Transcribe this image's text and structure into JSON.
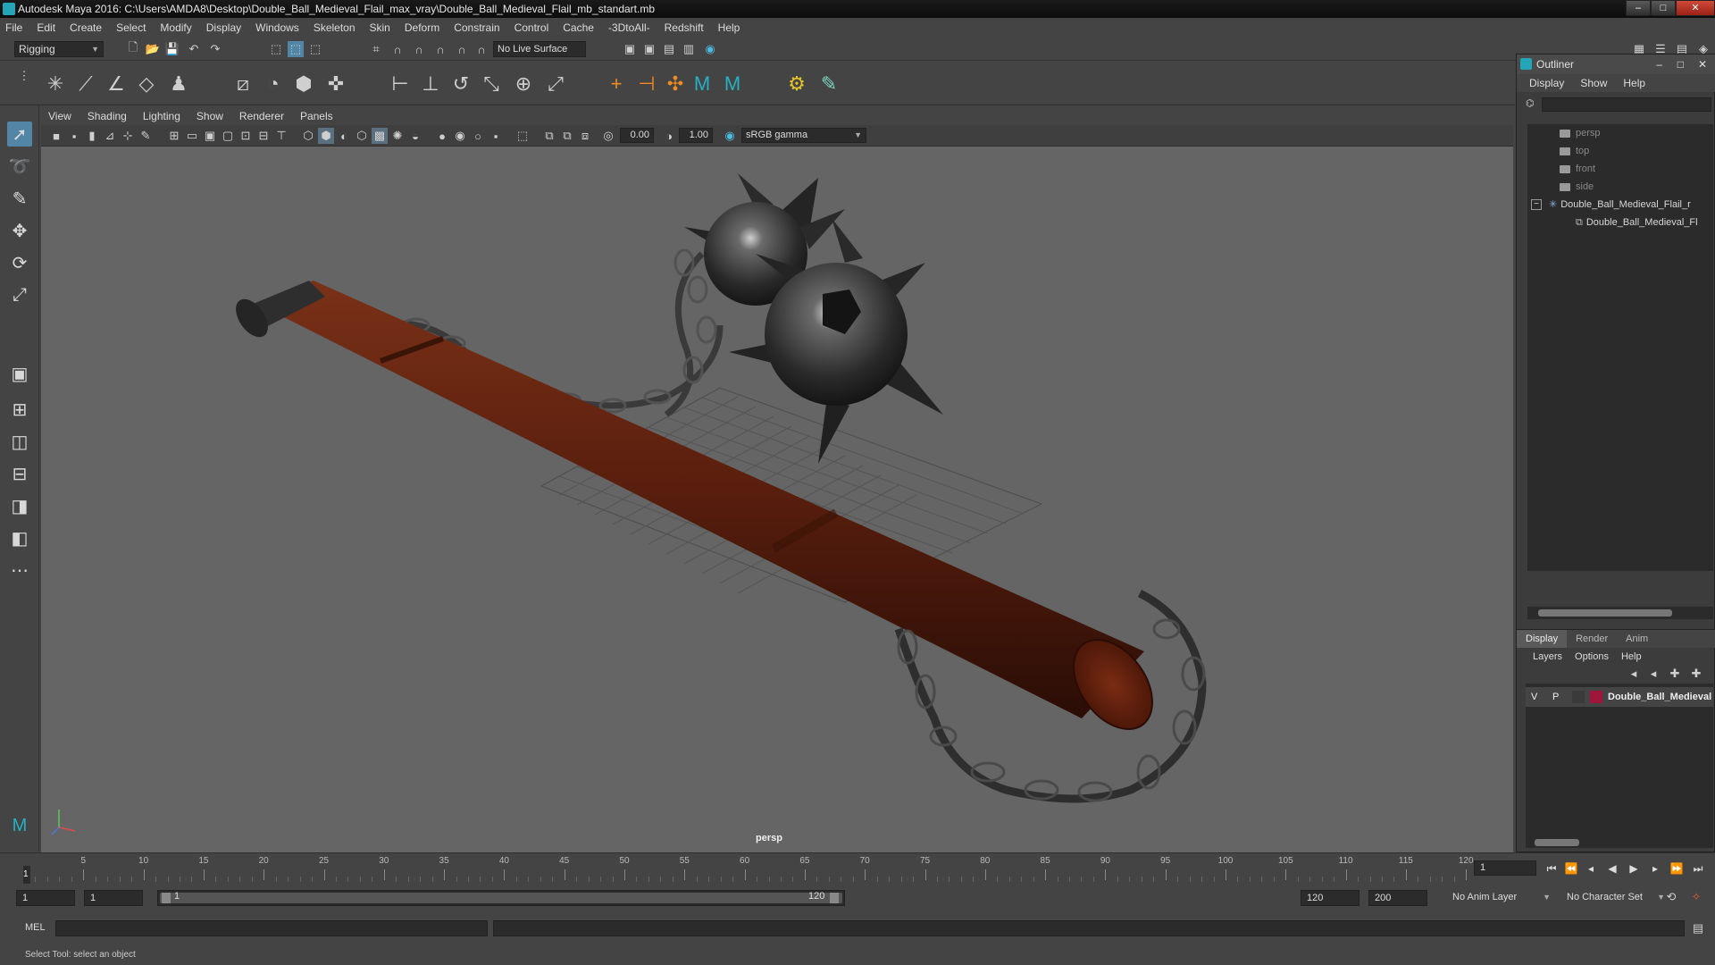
{
  "window": {
    "title": "Autodesk Maya 2016: C:\\Users\\AMDA8\\Desktop\\Double_Ball_Medieval_Flail_max_vray\\Double_Ball_Medieval_Flail_mb_standart.mb",
    "minimize": "–",
    "maximize": "□",
    "close": "✕"
  },
  "menubar": [
    "File",
    "Edit",
    "Create",
    "Select",
    "Modify",
    "Display",
    "Windows",
    "Skeleton",
    "Skin",
    "Deform",
    "Constrain",
    "Control",
    "Cache",
    "-3DtoAll-",
    "Redshift",
    "Help"
  ],
  "statusline": {
    "mode": "Rigging",
    "live_surface": "No Live Surface"
  },
  "viewport": {
    "menu": [
      "View",
      "Shading",
      "Lighting",
      "Show",
      "Renderer",
      "Panels"
    ],
    "exposure": "0.00",
    "gamma": "1.00",
    "color_space": "sRGB gamma",
    "camera": "persp"
  },
  "outliner": {
    "title": "Outliner",
    "menu": [
      "Display",
      "Show",
      "Help"
    ],
    "items": [
      {
        "label": "persp",
        "icon": "camera-icon",
        "dim": true
      },
      {
        "label": "top",
        "icon": "camera-icon",
        "dim": true
      },
      {
        "label": "front",
        "icon": "camera-icon",
        "dim": true
      },
      {
        "label": "side",
        "icon": "camera-icon",
        "dim": true
      },
      {
        "label": "Double_Ball_Medieval_Flail_r",
        "icon": "group-icon",
        "dim": false
      },
      {
        "label": "Double_Ball_Medieval_Fl",
        "icon": "mesh-icon",
        "dim": false
      }
    ]
  },
  "layers": {
    "tabs": [
      "Display",
      "Render",
      "Anim"
    ],
    "menu": [
      "Layers",
      "Options",
      "Help"
    ],
    "layer": {
      "v": "V",
      "p": "P",
      "name": "Double_Ball_Medieval",
      "color": "#a0163a"
    }
  },
  "timeline": {
    "ticks": [
      "5",
      "10",
      "15",
      "20",
      "25",
      "30",
      "35",
      "40",
      "45",
      "50",
      "55",
      "60",
      "65",
      "70",
      "75",
      "80",
      "85",
      "90",
      "95",
      "100",
      "105",
      "110",
      "115",
      "120"
    ],
    "current_frame_marker": "1",
    "current_frame": "1"
  },
  "range": {
    "start": "1",
    "playback_start": "1",
    "slider_start": "1",
    "slider_end": "120",
    "playback_end": "120",
    "end": "200",
    "anim_layer": "No Anim Layer",
    "character_set": "No Character Set"
  },
  "command": {
    "label": "MEL"
  },
  "help": "Select Tool: select an object",
  "colors": {
    "accent": "#5285a6",
    "maya_teal": "#22a6b8",
    "layer_color": "#a0163a"
  }
}
